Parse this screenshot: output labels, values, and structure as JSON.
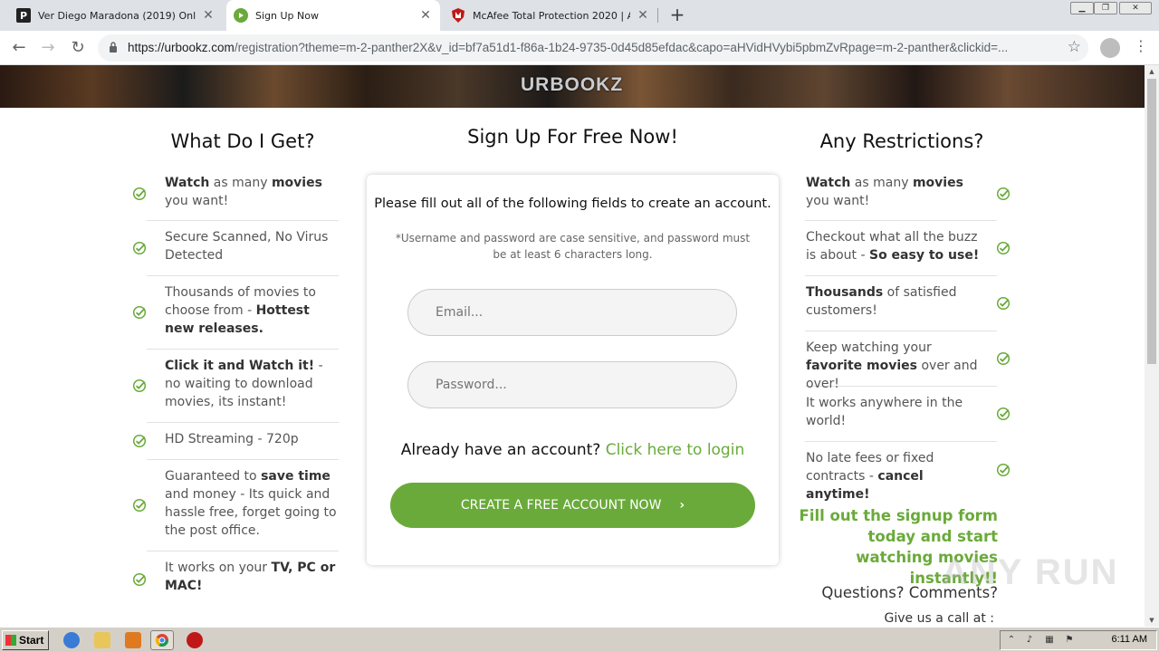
{
  "browser": {
    "tabs": [
      {
        "title": "Ver Diego Maradona (2019) Online Latino",
        "favicon_letter": "P",
        "active": false
      },
      {
        "title": "Sign Up Now",
        "favicon_letter": "",
        "active": true
      },
      {
        "title": "McAfee Total Protection 2020 | Antivirus",
        "favicon_letter": "",
        "active": false
      }
    ],
    "tab_close": "✕",
    "new_tab": "+",
    "url_host": "https://urbookz.com",
    "url_path": "/registration?theme=m-2-panther2X&v_id=bf7a51d1-f86a-1b24-9735-0d45d85efdac&capo=aHVidHVybi5pbmZvRpage=m-2-panther&clickid=..."
  },
  "site": {
    "logo": "URBOOKZ",
    "left_title": "What Do I Get?",
    "center_title": "Sign Up For Free Now!",
    "right_title": "Any Restrictions?",
    "left_features": [
      {
        "bold1": "Watch",
        "t1": " as many ",
        "bold2": "movies",
        "t2": " you want!"
      },
      {
        "bold1": "",
        "t1": "Secure Scanned, No Virus Detected",
        "bold2": "",
        "t2": ""
      },
      {
        "bold1": "",
        "t1": "Thousands of movies to choose from - ",
        "bold2": "Hottest new releases.",
        "t2": ""
      },
      {
        "bold1": "Click it and Watch it!",
        "t1": " - no waiting to download movies, its instant!",
        "bold2": "",
        "t2": ""
      },
      {
        "bold1": "",
        "t1": "HD Streaming - 720p",
        "bold2": "",
        "t2": ""
      },
      {
        "bold1": "",
        "t1": "Guaranteed to ",
        "bold2": "save time",
        "t2": " and money - Its quick and hassle free, forget going to the post office."
      },
      {
        "bold1": "",
        "t1": "It works on your ",
        "bold2": "TV, PC or MAC!",
        "t2": ""
      }
    ],
    "right_features": [
      {
        "bold1": "Watch",
        "t1": " as many ",
        "bold2": "movies",
        "t2": " you want!"
      },
      {
        "bold1": "",
        "t1": "Checkout what all the buzz is about - ",
        "bold2": "So easy to use!",
        "t2": ""
      },
      {
        "bold1": "Thousands",
        "t1": " of satisfied customers!",
        "bold2": "",
        "t2": ""
      },
      {
        "bold1": "",
        "t1": "Keep watching your ",
        "bold2": "favorite movies",
        "t2": " over and over!"
      },
      {
        "bold1": "",
        "t1": "It works anywhere in the world!",
        "bold2": "",
        "t2": ""
      },
      {
        "bold1": "",
        "t1": "No late fees or fixed contracts - ",
        "bold2": "cancel anytime!",
        "t2": ""
      }
    ],
    "form": {
      "lead": "Please fill out all of the following fields to create an account.",
      "note": "*Username and password are case sensitive, and password must be at least 6 characters long.",
      "email_placeholder": "Email...",
      "password_placeholder": "Password...",
      "login_prompt": "Already have an account?",
      "login_link": "Click here to login",
      "cta_label": "CREATE A FREE ACCOUNT NOW",
      "cta_chevron": "›"
    },
    "green_note": "Fill out the signup form today and start watching movies instantly!!",
    "questions": "Questions? Comments?",
    "call_us": "Give us a call at :"
  },
  "watermark": "ANY RUN",
  "taskbar": {
    "start_label": "Start",
    "clock": "6:11 AM"
  },
  "colors": {
    "accent_green": "#6aaa3a",
    "chrome_bg": "#dee1e6"
  }
}
